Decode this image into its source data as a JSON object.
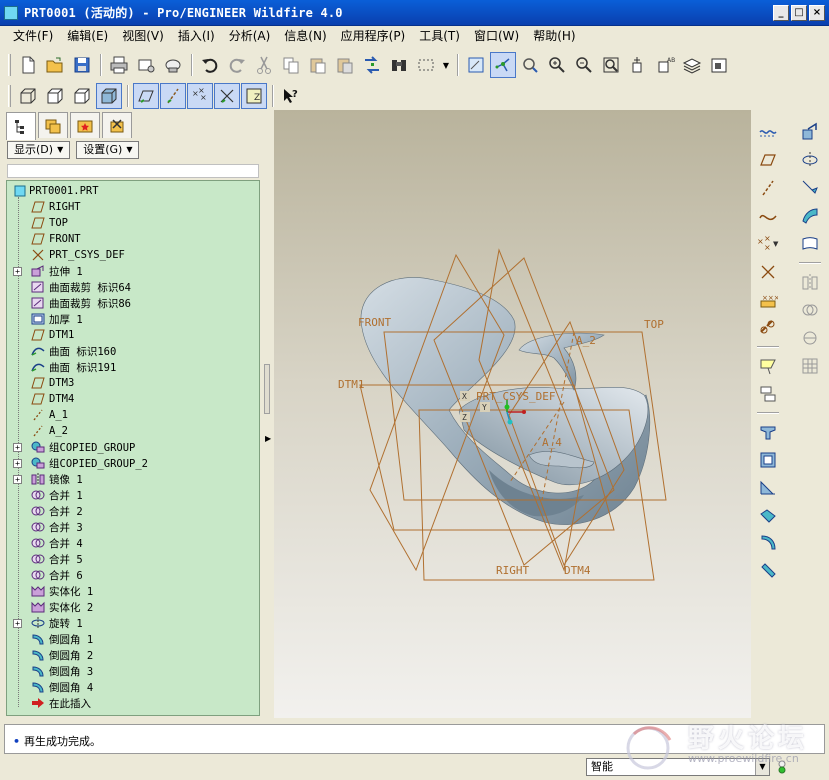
{
  "window": {
    "title": "PRT0001 (活动的) - Pro/ENGINEER Wildfire 4.0",
    "min": "_",
    "max": "□",
    "close": "×"
  },
  "menu": [
    {
      "label": "文件(F)"
    },
    {
      "label": "编辑(E)"
    },
    {
      "label": "视图(V)"
    },
    {
      "label": "插入(I)"
    },
    {
      "label": "分析(A)"
    },
    {
      "label": "信息(N)"
    },
    {
      "label": "应用程序(P)"
    },
    {
      "label": "工具(T)"
    },
    {
      "label": "窗口(W)"
    },
    {
      "label": "帮助(H)"
    }
  ],
  "panel": {
    "show_btn": "显示(D)",
    "settings_btn": "设置(G)",
    "root": "PRT0001.PRT",
    "items": [
      {
        "label": "RIGHT",
        "icon": "datum-plane-icon",
        "exp": false
      },
      {
        "label": "TOP",
        "icon": "datum-plane-icon",
        "exp": false
      },
      {
        "label": "FRONT",
        "icon": "datum-plane-icon",
        "exp": false
      },
      {
        "label": "PRT_CSYS_DEF",
        "icon": "csys-icon",
        "exp": false
      },
      {
        "label": "拉伸 1",
        "icon": "extrude-icon",
        "exp": true
      },
      {
        "label": "曲面裁剪 标识64",
        "icon": "surface-trim-icon",
        "exp": false
      },
      {
        "label": "曲面裁剪 标识86",
        "icon": "surface-trim-icon",
        "exp": false
      },
      {
        "label": "加厚 1",
        "icon": "thicken-icon",
        "exp": false
      },
      {
        "label": "DTM1",
        "icon": "datum-plane-icon",
        "exp": false
      },
      {
        "label": "曲面 标识160",
        "icon": "surface-icon",
        "exp": false
      },
      {
        "label": "曲面 标识191",
        "icon": "surface-icon",
        "exp": false
      },
      {
        "label": "DTM3",
        "icon": "datum-plane-icon",
        "exp": false
      },
      {
        "label": "DTM4",
        "icon": "datum-plane-icon",
        "exp": false
      },
      {
        "label": "A_1",
        "icon": "datum-axis-icon",
        "exp": false
      },
      {
        "label": "A_2",
        "icon": "datum-axis-icon",
        "exp": false
      },
      {
        "label": "组COPIED_GROUP",
        "icon": "group-icon",
        "exp": true
      },
      {
        "label": "组COPIED_GROUP_2",
        "icon": "group-icon",
        "exp": true
      },
      {
        "label": "镜像 1",
        "icon": "mirror-icon",
        "exp": true
      },
      {
        "label": "合并 1",
        "icon": "merge-icon",
        "exp": false
      },
      {
        "label": "合并 2",
        "icon": "merge-icon",
        "exp": false
      },
      {
        "label": "合并 3",
        "icon": "merge-icon",
        "exp": false
      },
      {
        "label": "合并 4",
        "icon": "merge-icon",
        "exp": false
      },
      {
        "label": "合并 5",
        "icon": "merge-icon",
        "exp": false
      },
      {
        "label": "合并 6",
        "icon": "merge-icon",
        "exp": false
      },
      {
        "label": "实体化 1",
        "icon": "solidify-icon",
        "exp": false
      },
      {
        "label": "实体化 2",
        "icon": "solidify-icon",
        "exp": false
      },
      {
        "label": "旋转 1",
        "icon": "revolve-icon",
        "exp": true
      },
      {
        "label": "倒圆角 1",
        "icon": "round-icon",
        "exp": false
      },
      {
        "label": "倒圆角 2",
        "icon": "round-icon",
        "exp": false
      },
      {
        "label": "倒圆角 3",
        "icon": "round-icon",
        "exp": false
      },
      {
        "label": "倒圆角 4",
        "icon": "round-icon",
        "exp": false
      },
      {
        "label": "在此插入",
        "icon": "insert-here-icon",
        "exp": false
      }
    ]
  },
  "viewport": {
    "labels": {
      "front": "FRONT",
      "top": "TOP",
      "dtm1": "DTM1",
      "a2": "A_2",
      "csys": "PRT_CSYS_DEF",
      "a4": "A_4",
      "right": "RIGHT",
      "dtm4": "DTM4",
      "x": "X",
      "y": "Y",
      "z": "Z"
    },
    "datum_color": "#b07030",
    "model_color": "#9fb0bd"
  },
  "message": "再生成功完成。",
  "status": {
    "filter": "智能"
  },
  "watermark": {
    "title": "野火论坛",
    "url": "www.proewildfire.cn"
  }
}
